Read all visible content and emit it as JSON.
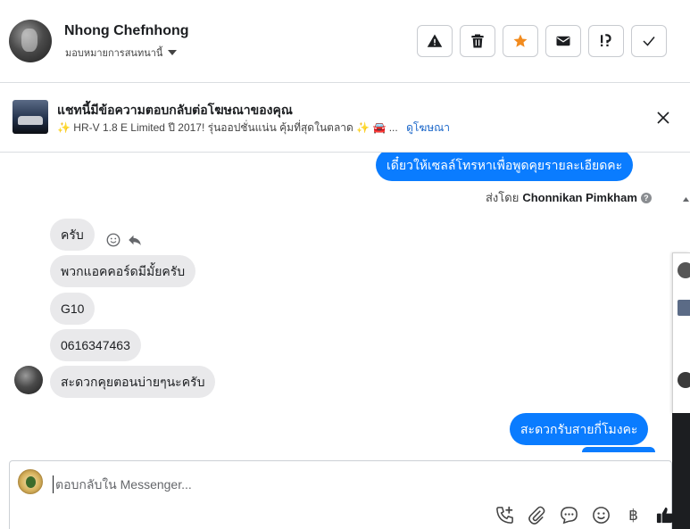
{
  "header": {
    "name": "Nhong Chefnhong",
    "assign_label": "มอบหมายการสนทนานี้",
    "accent_color": "#f28b1e"
  },
  "ad_banner": {
    "title": "แชทนี้มีข้อความตอบกลับต่อโฆษณาของคุณ",
    "description": "✨ HR-V 1.8 E Limited ปี 2017! รุ่นออปชั่นแน่น คุ้มที่สุดในตลาด ✨ 🚘 ...",
    "link": "ดูโฆษณา"
  },
  "messages": {
    "out_1": "เดี๋ยวให้เซลล์โทรหาเพื่อพูดคุยรายละเอียดคะ",
    "sent_by_prefix": "ส่งโดย",
    "sent_by_name": "Chonnikan Pimkham",
    "in_1": "ครับ",
    "in_2": "พวกแอคคอร์ดมีมั้ยครับ",
    "in_3": "G10",
    "in_4": "0616347463",
    "in_5": "สะดวกคุยตอนบ่ายๆนะครับ",
    "out_2": "สะดวกรับสายกี่โมงคะ"
  },
  "composer": {
    "placeholder": "ตอบกลับใน Messenger..."
  },
  "colors": {
    "outgoing": "#0a7cff",
    "incoming": "#e9e9eb"
  }
}
